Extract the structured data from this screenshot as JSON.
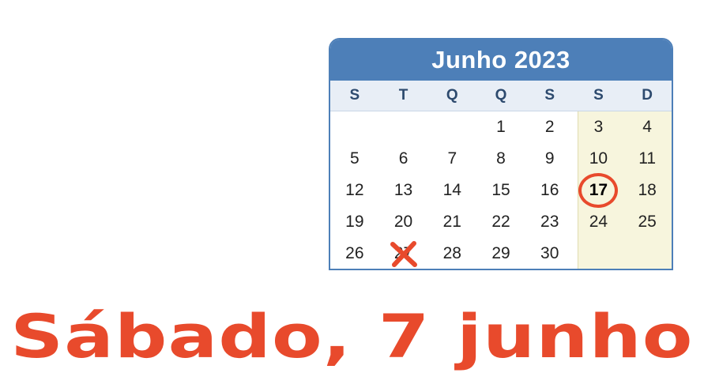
{
  "calendar": {
    "title": "Junho 2023",
    "weekdays": [
      "S",
      "T",
      "Q",
      "Q",
      "S",
      "S",
      "D"
    ],
    "days": [
      [
        "",
        "",
        "",
        "1",
        "2",
        "3",
        "4"
      ],
      [
        "5",
        "6",
        "7",
        "8",
        "9",
        "10",
        "11"
      ],
      [
        "12",
        "13",
        "14",
        "15",
        "16",
        "17",
        "18"
      ],
      [
        "19",
        "20",
        "21",
        "22",
        "23",
        "24",
        "25"
      ],
      [
        "26",
        "27",
        "28",
        "29",
        "30",
        "",
        ""
      ]
    ],
    "highlighted_day": "17",
    "crossed_day": "27"
  },
  "caption": "Sábado, 7 junho",
  "colors": {
    "header": "#4d7fb8",
    "accent": "#e84a2c",
    "weekend": "#f7f5dd"
  }
}
